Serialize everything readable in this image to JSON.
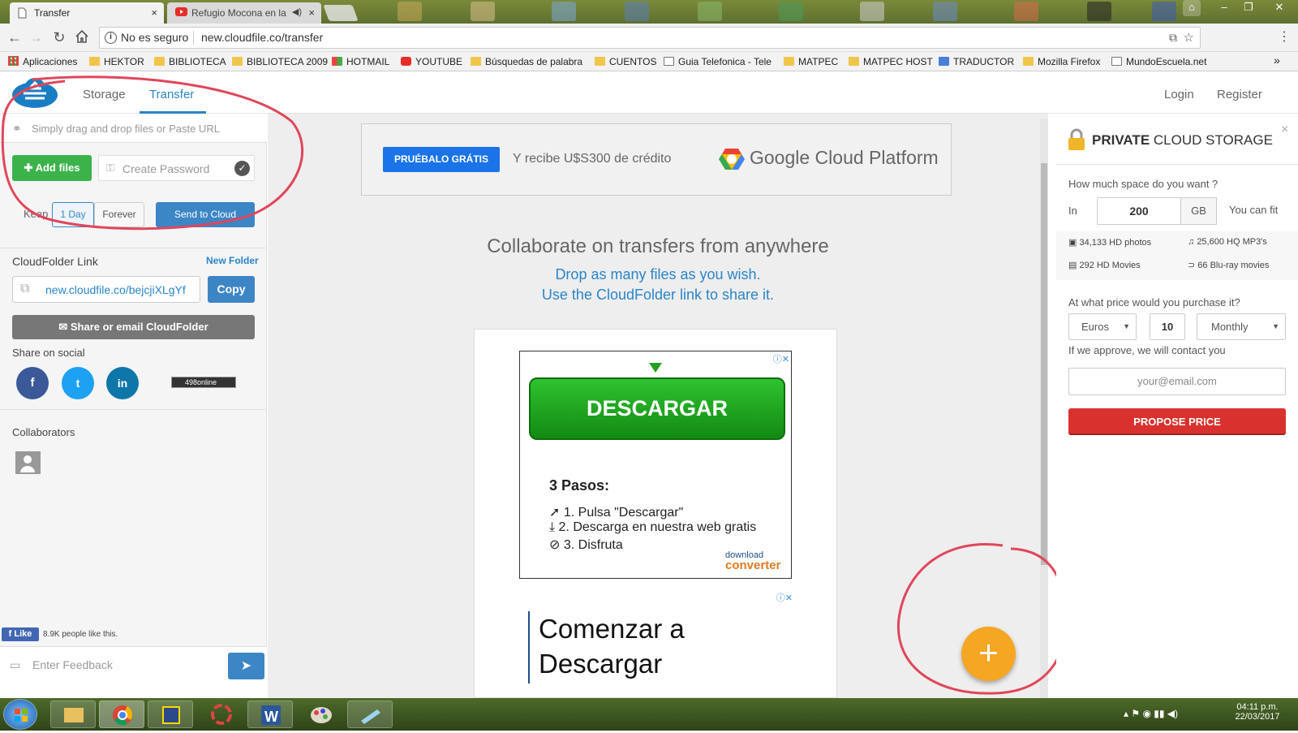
{
  "browser": {
    "tabs": [
      {
        "title": "Transfer",
        "close": "×"
      },
      {
        "title": "Refugio Mocona en la",
        "close": "×"
      }
    ],
    "security": "No es seguro",
    "url": "new.cloudfile.co/transfer",
    "bookmarks": [
      "Aplicaciones",
      "HEKTOR",
      "BIBLIOTECA",
      "BIBLIOTECA 2009",
      "HOTMAIL",
      "YOUTUBE",
      "Búsquedas de palabra",
      "CUENTOS",
      "Guia Telefonica - Tele",
      "MATPEC",
      "MATPEC HOST",
      "TRADUCTOR",
      "Mozilla Firefox",
      "MundoEscuela.net"
    ],
    "more": "»"
  },
  "header": {
    "nav": [
      "Storage",
      "Transfer"
    ],
    "login": "Login",
    "register": "Register"
  },
  "left": {
    "drop_hint": "Simply drag and drop files or Paste URL",
    "add_files": "Add files",
    "password_placeholder": "Create Password",
    "keep_label": "Keep",
    "keep_options": [
      "1 Day",
      "Forever"
    ],
    "send": "Send to Cloud",
    "cloudfolder_label": "CloudFolder Link",
    "new_folder": "New Folder",
    "cloudfolder_link": "new.cloudfile.co/bejcjiXLgYf",
    "copy": "Copy",
    "share_email": "Share or email CloudFolder",
    "share_social": "Share on social",
    "social": [
      "f",
      "t",
      "in"
    ],
    "online_badge": "498online",
    "collaborators": "Collaborators",
    "fb_like": "Like",
    "fb_count": "8.9K people like this.",
    "feedback_placeholder": "Enter Feedback"
  },
  "main": {
    "ad_cta": "PRUÉBALO GRÁTIS",
    "ad_text": "Y recibe U$S300 de crédito",
    "ad_brand": "Google Cloud Platform",
    "headline": "Collaborate on transfers from anywhere",
    "sub1": "Drop as many files as you wish.",
    "sub2": "Use the CloudFolder link to share it.",
    "ad2_button": "DESCARGAR",
    "ad2_steps_title": "3 Pasos:",
    "ad2_steps": [
      "1. Pulsa \"Descargar\"",
      "2. Descarga en nuestra web gratis",
      "3. Disfruta"
    ],
    "ad2_brand_top": "download",
    "ad2_brand_bottom": "converter",
    "ad3_text1": "Comenzar a",
    "ad3_text2": "Descargar",
    "fab": "+"
  },
  "right": {
    "title_bold": "PRIVATE",
    "title_rest": " CLOUD STORAGE",
    "close": "×",
    "question": "How much space do you want ?",
    "in_label": "In",
    "gb_value": "200",
    "gb_unit": "GB",
    "can_fit": "You can fit",
    "fits": [
      "34,133 HD photos",
      "25,600 HQ MP3's",
      "292 HD Movies",
      "66 Blu-ray movies"
    ],
    "price_question": "At what price would you purchase it?",
    "currency": "Euros",
    "price": "10",
    "period": "Monthly",
    "approve": "If we approve, we will contact you",
    "email_placeholder": "your@email.com",
    "propose": "PROPOSE PRICE"
  },
  "taskbar": {
    "time": "04:11 p.m.",
    "date": "22/03/2017"
  },
  "colors": {
    "accent_blue": "#3d86c6",
    "green": "#3cb34a",
    "red": "#d9322e",
    "orange": "#f5a623",
    "annotation": "#e0465a"
  }
}
